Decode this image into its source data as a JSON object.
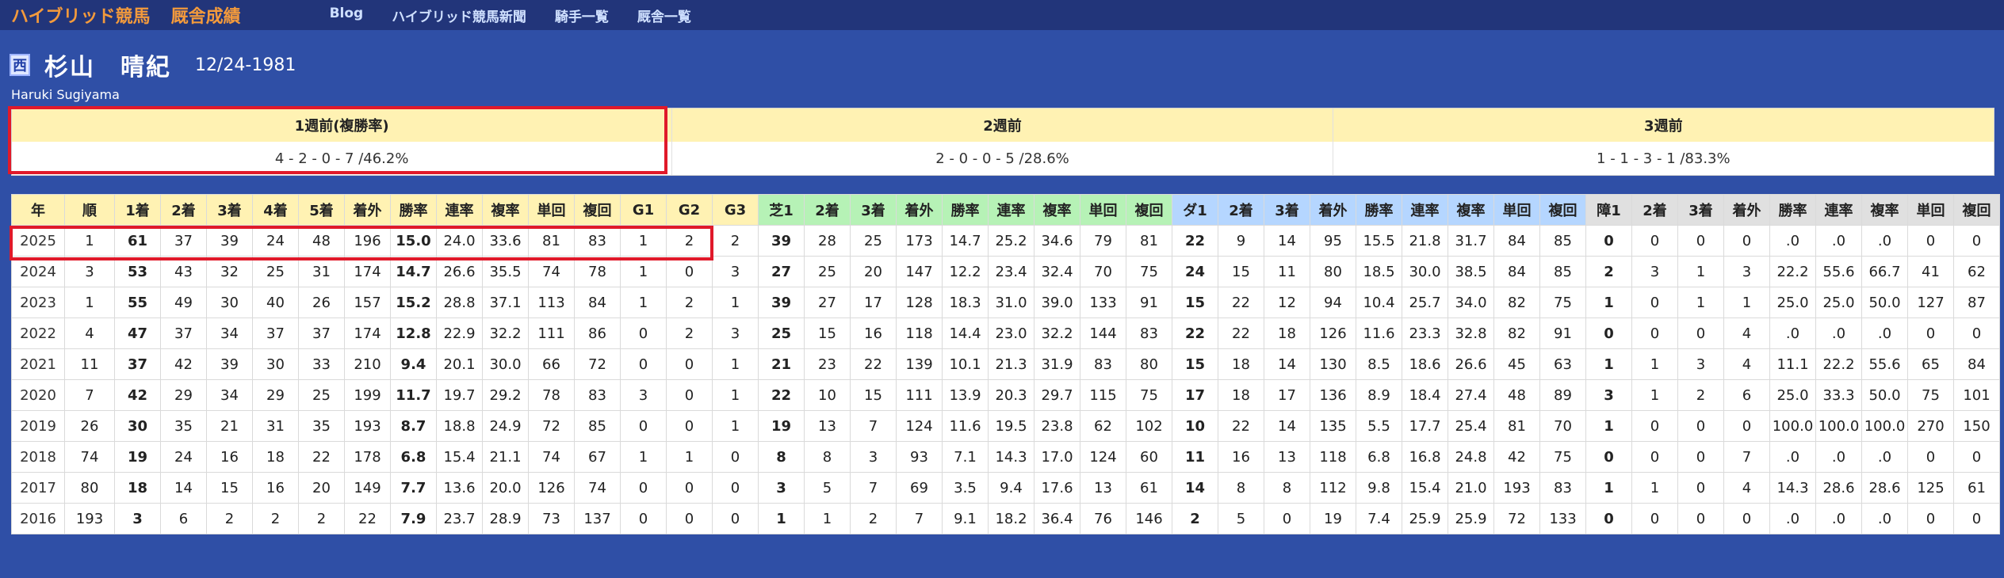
{
  "header": {
    "site_title": "ハイブリッド競馬",
    "site_subtitle": "厩舎成績",
    "nav": [
      "Blog",
      "ハイブリッド競馬新聞",
      "騎手一覧",
      "厩舎一覧"
    ]
  },
  "profile": {
    "region": "西",
    "name": "杉山　晴紀",
    "birth": "12/24-1981",
    "romaji": "Haruki Sugiyama"
  },
  "summary": [
    {
      "head": "1週前(複勝率)",
      "value": "4 - 2 - 0 - 7 /46.2%"
    },
    {
      "head": "2週前",
      "value": "2 - 0 - 0 - 5 /28.6%"
    },
    {
      "head": "3週前",
      "value": "1 - 1 - 3 - 1 /83.3%"
    }
  ],
  "table": {
    "headers": [
      "年",
      "順",
      "1着",
      "2着",
      "3着",
      "4着",
      "5着",
      "着外",
      "勝率",
      "連率",
      "複率",
      "単回",
      "複回",
      "G1",
      "G2",
      "G3",
      "芝1",
      "2着",
      "3着",
      "着外",
      "勝率",
      "連率",
      "複率",
      "単回",
      "複回",
      "ダ1",
      "2着",
      "3着",
      "着外",
      "勝率",
      "連率",
      "複率",
      "単回",
      "複回",
      "障1",
      "2着",
      "3着",
      "着外",
      "勝率",
      "連率",
      "複率",
      "単回",
      "複回"
    ],
    "rows": [
      [
        "2025",
        "1",
        "61",
        "37",
        "39",
        "24",
        "48",
        "196",
        "15.0",
        "24.0",
        "33.6",
        "81",
        "83",
        "1",
        "2",
        "2",
        "39",
        "28",
        "25",
        "173",
        "14.7",
        "25.2",
        "34.6",
        "79",
        "81",
        "22",
        "9",
        "14",
        "95",
        "15.5",
        "21.8",
        "31.7",
        "84",
        "85",
        "0",
        "0",
        "0",
        "0",
        ".0",
        ".0",
        ".0",
        "0",
        "0"
      ],
      [
        "2024",
        "3",
        "53",
        "43",
        "32",
        "25",
        "31",
        "174",
        "14.7",
        "26.6",
        "35.5",
        "74",
        "78",
        "1",
        "0",
        "3",
        "27",
        "25",
        "20",
        "147",
        "12.2",
        "23.4",
        "32.4",
        "70",
        "75",
        "24",
        "15",
        "11",
        "80",
        "18.5",
        "30.0",
        "38.5",
        "84",
        "85",
        "2",
        "3",
        "1",
        "3",
        "22.2",
        "55.6",
        "66.7",
        "41",
        "62"
      ],
      [
        "2023",
        "1",
        "55",
        "49",
        "30",
        "40",
        "26",
        "157",
        "15.2",
        "28.8",
        "37.1",
        "113",
        "84",
        "1",
        "2",
        "1",
        "39",
        "27",
        "17",
        "128",
        "18.3",
        "31.0",
        "39.0",
        "133",
        "91",
        "15",
        "22",
        "12",
        "94",
        "10.4",
        "25.7",
        "34.0",
        "82",
        "75",
        "1",
        "0",
        "1",
        "1",
        "25.0",
        "25.0",
        "50.0",
        "127",
        "87"
      ],
      [
        "2022",
        "4",
        "47",
        "37",
        "34",
        "37",
        "37",
        "174",
        "12.8",
        "22.9",
        "32.2",
        "111",
        "86",
        "0",
        "2",
        "3",
        "25",
        "15",
        "16",
        "118",
        "14.4",
        "23.0",
        "32.2",
        "144",
        "83",
        "22",
        "22",
        "18",
        "126",
        "11.6",
        "23.3",
        "32.8",
        "82",
        "91",
        "0",
        "0",
        "0",
        "4",
        ".0",
        ".0",
        ".0",
        "0",
        "0"
      ],
      [
        "2021",
        "11",
        "37",
        "42",
        "39",
        "30",
        "33",
        "210",
        "9.4",
        "20.1",
        "30.0",
        "66",
        "72",
        "0",
        "0",
        "1",
        "21",
        "23",
        "22",
        "139",
        "10.1",
        "21.3",
        "31.9",
        "83",
        "80",
        "15",
        "18",
        "14",
        "130",
        "8.5",
        "18.6",
        "26.6",
        "45",
        "63",
        "1",
        "1",
        "3",
        "4",
        "11.1",
        "22.2",
        "55.6",
        "65",
        "84"
      ],
      [
        "2020",
        "7",
        "42",
        "29",
        "34",
        "29",
        "25",
        "199",
        "11.7",
        "19.7",
        "29.2",
        "78",
        "83",
        "3",
        "0",
        "1",
        "22",
        "10",
        "15",
        "111",
        "13.9",
        "20.3",
        "29.7",
        "115",
        "75",
        "17",
        "18",
        "17",
        "136",
        "8.9",
        "18.4",
        "27.4",
        "48",
        "89",
        "3",
        "1",
        "2",
        "6",
        "25.0",
        "33.3",
        "50.0",
        "75",
        "101"
      ],
      [
        "2019",
        "26",
        "30",
        "35",
        "21",
        "31",
        "35",
        "193",
        "8.7",
        "18.8",
        "24.9",
        "72",
        "85",
        "0",
        "0",
        "1",
        "19",
        "13",
        "7",
        "124",
        "11.6",
        "19.5",
        "23.8",
        "62",
        "102",
        "10",
        "22",
        "14",
        "135",
        "5.5",
        "17.7",
        "25.4",
        "81",
        "70",
        "1",
        "0",
        "0",
        "0",
        "100.0",
        "100.0",
        "100.0",
        "270",
        "150"
      ],
      [
        "2018",
        "74",
        "19",
        "24",
        "16",
        "18",
        "22",
        "178",
        "6.8",
        "15.4",
        "21.1",
        "74",
        "67",
        "1",
        "1",
        "0",
        "8",
        "8",
        "3",
        "93",
        "7.1",
        "14.3",
        "17.0",
        "124",
        "60",
        "11",
        "16",
        "13",
        "118",
        "6.8",
        "16.8",
        "24.8",
        "42",
        "75",
        "0",
        "0",
        "0",
        "7",
        ".0",
        ".0",
        ".0",
        "0",
        "0"
      ],
      [
        "2017",
        "80",
        "18",
        "14",
        "15",
        "16",
        "20",
        "149",
        "7.7",
        "13.6",
        "20.0",
        "126",
        "74",
        "0",
        "0",
        "0",
        "3",
        "5",
        "7",
        "69",
        "3.5",
        "9.4",
        "17.6",
        "13",
        "61",
        "14",
        "8",
        "8",
        "112",
        "9.8",
        "15.4",
        "21.0",
        "193",
        "83",
        "1",
        "1",
        "0",
        "4",
        "14.3",
        "28.6",
        "28.6",
        "125",
        "61"
      ],
      [
        "2016",
        "193",
        "3",
        "6",
        "2",
        "2",
        "2",
        "22",
        "7.9",
        "23.7",
        "28.9",
        "73",
        "137",
        "0",
        "0",
        "0",
        "1",
        "1",
        "2",
        "7",
        "9.1",
        "18.2",
        "36.4",
        "76",
        "146",
        "2",
        "5",
        "0",
        "19",
        "7.4",
        "25.9",
        "25.9",
        "72",
        "133",
        "0",
        "0",
        "0",
        "0",
        ".0",
        ".0",
        ".0",
        "0",
        "0"
      ]
    ]
  }
}
